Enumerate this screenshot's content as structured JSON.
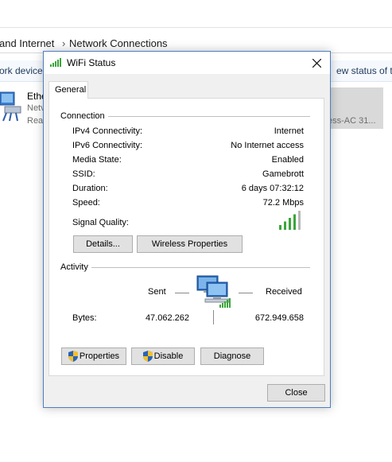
{
  "background": {
    "breadcrumb": {
      "parent": "and Internet",
      "separator": "›",
      "current": "Network Connections"
    },
    "command_bar": {
      "left_command": "ork device",
      "right_command": "ew status of th"
    },
    "connection_item": {
      "name": "Ethe",
      "line1": "Netv",
      "line2": "Rea"
    },
    "selected_item_text": "ess-AC 31..."
  },
  "dialog": {
    "title": "WiFi Status",
    "tab_label": "General",
    "connection": {
      "section_label": "Connection",
      "rows": [
        {
          "label": "IPv4 Connectivity:",
          "value": "Internet"
        },
        {
          "label": "IPv6 Connectivity:",
          "value": "No Internet access"
        },
        {
          "label": "Media State:",
          "value": "Enabled"
        },
        {
          "label": "SSID:",
          "value": "Gamebrott"
        },
        {
          "label": "Duration:",
          "value": "6 days 07:32:12"
        },
        {
          "label": "Speed:",
          "value": "72.2 Mbps"
        }
      ],
      "signal_label": "Signal Quality:",
      "signal_bars_filled": 4,
      "signal_bars_total": 5,
      "details_button": "Details...",
      "wireless_button": "Wireless Properties"
    },
    "activity": {
      "section_label": "Activity",
      "sent_label": "Sent",
      "received_label": "Received",
      "bytes_label": "Bytes:",
      "bytes_sent": "47.062.262",
      "bytes_received": "672.949.658"
    },
    "buttons": {
      "properties": "Properties",
      "disable": "Disable",
      "diagnose": "Diagnose",
      "close": "Close"
    }
  },
  "colors": {
    "accent_border": "#4a7fc2",
    "signal_green": "#3aa53a",
    "signal_empty": "#b8b8b8"
  }
}
